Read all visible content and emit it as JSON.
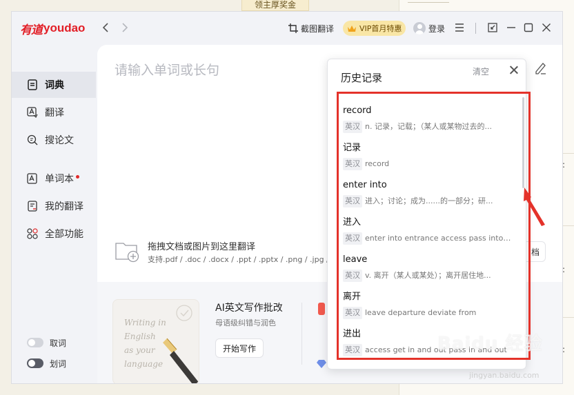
{
  "background": {
    "tab_text": "领主厚奖金",
    "marks": [
      ":",
      ":",
      ":"
    ]
  },
  "app": {
    "logo_cn": "有道",
    "logo_en": "youdao",
    "screenshot_translate": "截图翻译",
    "vip_label": "VIP首月特惠",
    "login_label": "登录"
  },
  "sidebar": {
    "items": [
      {
        "label": "词典",
        "icon": "dictionary-icon"
      },
      {
        "label": "翻译",
        "icon": "translate-icon"
      },
      {
        "label": "搜论文",
        "icon": "search-paper-icon"
      },
      {
        "label": "单词本",
        "icon": "wordbook-icon"
      },
      {
        "label": "我的翻译",
        "icon": "my-translation-icon"
      },
      {
        "label": "全部功能",
        "icon": "all-features-icon"
      }
    ],
    "toggles": [
      {
        "label": "取词",
        "state": "off"
      },
      {
        "label": "划词",
        "state": "on"
      }
    ]
  },
  "main": {
    "search_placeholder": "请输入单词或长句",
    "upload_title": "拖拽文档或图片到这里翻译",
    "upload_sub": "支持.pdf / .doc / .docx / .ppt / .pptx / .png / .jpg / ...",
    "doc_button_fragment": "档",
    "ai_title": "AI英文写作批改",
    "ai_sub": "母语级纠错与润色",
    "start_button": "开始写作",
    "card_handwriting": [
      "Writing in",
      "English",
      "as your",
      "language"
    ]
  },
  "history": {
    "title": "历史记录",
    "clear_label": "清空",
    "items": [
      {
        "word": "record",
        "tag": "英汉",
        "def": "n. 记录，记载；（某人或某物过去的..."
      },
      {
        "word": "记录",
        "tag": "英汉",
        "def": "record"
      },
      {
        "word": "enter into",
        "tag": "英汉",
        "def": "进入；讨论；成为......的一部分；研..."
      },
      {
        "word": "进入",
        "tag": "英汉",
        "def": "enter into entrance access pass into t..."
      },
      {
        "word": "leave",
        "tag": "英汉",
        "def": "v. 离开（某人或某处）；离开居住地..."
      },
      {
        "word": "离开",
        "tag": "英汉",
        "def": "leave departure deviate from"
      },
      {
        "word": "进出",
        "tag": "英汉",
        "def": "access get in and out pass in and out"
      }
    ]
  },
  "watermark": {
    "text": "Baidu 经验",
    "sub": "jingyan.baidu.com"
  },
  "colors": {
    "brand": "#e21e26",
    "highlight_box": "#e4322a",
    "vip_bg": "#f9e6a6"
  }
}
